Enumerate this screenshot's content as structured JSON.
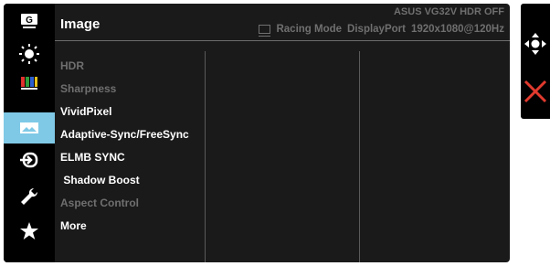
{
  "osd": {
    "title": "Image",
    "model": "ASUS VG32V HDR OFF",
    "input_mode": "Racing Mode",
    "input_source": "DisplayPort",
    "resolution": "1920x1080@120Hz"
  },
  "sidebar": {
    "items": [
      {
        "name": "gamevisual",
        "icon": "G"
      },
      {
        "name": "blue-light-filter",
        "icon": "sun"
      },
      {
        "name": "color",
        "icon": "color-bars"
      },
      {
        "name": "image",
        "icon": "image",
        "active": true
      },
      {
        "name": "input-select",
        "icon": "input"
      },
      {
        "name": "system-setup",
        "icon": "wrench"
      },
      {
        "name": "myfavorite",
        "icon": "star"
      }
    ]
  },
  "menu": {
    "items": [
      {
        "label": "HDR",
        "enabled": false
      },
      {
        "label": "Sharpness",
        "enabled": false
      },
      {
        "label": "VividPixel",
        "enabled": true
      },
      {
        "label": "Adaptive-Sync/FreeSync",
        "enabled": true
      },
      {
        "label": "ELMB SYNC",
        "enabled": true
      },
      {
        "label": " Shadow Boost",
        "enabled": true
      },
      {
        "label": "Aspect Control",
        "enabled": false
      },
      {
        "label": "More",
        "enabled": true
      }
    ]
  },
  "colors": {
    "osd_bg": "#1a1a1a",
    "active_item": "#7fc9e6",
    "disabled_text": "#6f6f6f",
    "close_red": "#e23a2e"
  },
  "nav": {
    "buttons": [
      {
        "name": "navigation-joystick",
        "icon": "four-way-arrows"
      },
      {
        "name": "close-button",
        "icon": "x"
      }
    ]
  }
}
